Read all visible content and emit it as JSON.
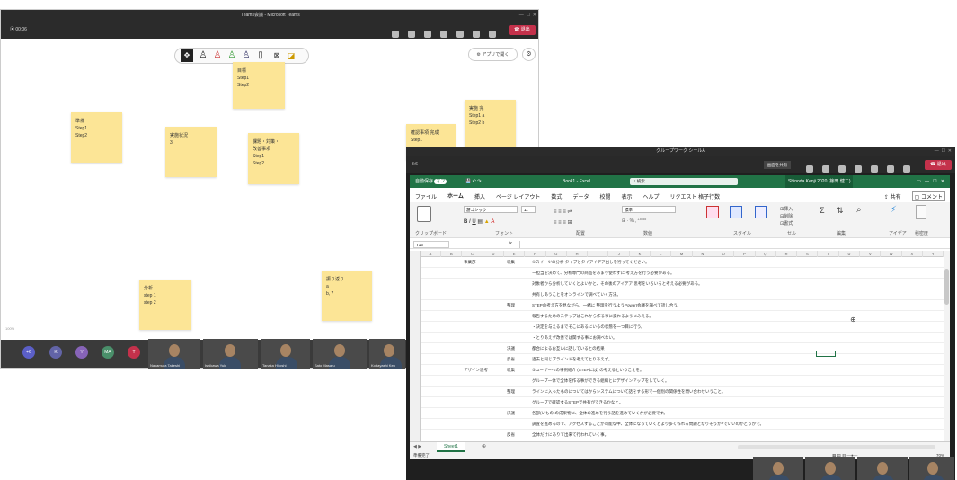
{
  "whiteboard_window": {
    "title": "Teams会議 - Microsoft Teams",
    "timer": "00:06",
    "leave_label": "退出",
    "app_button": "アプリで開く",
    "notes": [
      {
        "id": "top",
        "lines": [
          "目標",
          "Step1",
          "Step2"
        ]
      },
      {
        "id": "left",
        "lines": [
          "準備",
          "Step1",
          "Step2"
        ]
      },
      {
        "id": "mid1",
        "lines": [
          "実施状況",
          "3"
        ]
      },
      {
        "id": "mid2",
        "lines": [
          "課題・対策・",
          "改善事項",
          "Step1",
          "Step2"
        ]
      },
      {
        "id": "right1",
        "lines": [
          "実施 完",
          "Step1 a",
          "Step2 b"
        ]
      },
      {
        "id": "right2",
        "lines": [
          "確認事項 完成",
          "Step1"
        ]
      },
      {
        "id": "bottom1",
        "lines": [
          "分析",
          "step 1",
          "step 2"
        ]
      },
      {
        "id": "bottom2",
        "lines": [
          "振り返り",
          "a",
          "b, 7"
        ]
      }
    ],
    "zoom_label": "100%",
    "avatars": [
      {
        "label": "+6",
        "color": "#5b5fc7"
      },
      {
        "label": "K",
        "color": "#6264a7"
      },
      {
        "label": "Y",
        "color": "#8764b8"
      },
      {
        "label": "MA",
        "color": "#4a8f6a"
      },
      {
        "label": "T",
        "color": "#c4314b"
      }
    ],
    "video_names": [
      "Nakamura Takeshi",
      "Ishikawa Yuki",
      "Tanaka Hiroshi",
      "Sato Masaru",
      "Kobayashi Ken"
    ]
  },
  "excel_window": {
    "title": "グループワーク シールA",
    "left_timer": "3:6",
    "share_button": "画面を共有",
    "leave_label": "退出",
    "autosave": "自動保存",
    "autosave_state": "オフ",
    "file_name": "Book1 - Excel",
    "search_placeholder": "検索",
    "user": "Shinoda Kenji 2020 (篠田 健二)",
    "tabs": [
      "ファイル",
      "ホーム",
      "挿入",
      "ページ レイアウト",
      "数式",
      "データ",
      "校閲",
      "表示",
      "ヘルプ",
      "リクエスト 格子行数"
    ],
    "share_label": "共有",
    "comment_label": "コメント",
    "font_name": "游ゴシック",
    "font_size": "11",
    "number_format": "標準",
    "groups": [
      "クリップボード",
      "フォント",
      "配置",
      "数値",
      "スタイル",
      "セル",
      "編集",
      "アイデア",
      "秘密度"
    ],
    "name_box": "T16",
    "formula_fx": "fx",
    "column_headers": [
      "A",
      "B",
      "C",
      "D",
      "E",
      "F",
      "G",
      "H",
      "I",
      "J",
      "K",
      "L",
      "M",
      "N",
      "O",
      "P",
      "Q",
      "R",
      "S",
      "T",
      "U",
      "V",
      "W",
      "X",
      "Y"
    ],
    "rows": [
      {
        "label": "",
        "b": "事業部",
        "c": "収集",
        "text": "①スイーツの分析 タイプとタイアイデア出しを行ってください。"
      },
      {
        "label": "",
        "b": "",
        "c": "",
        "text": "ー担当を決めて、分析専門の商品をあまり使わずに 考え方を行う必要がある。"
      },
      {
        "label": "",
        "b": "",
        "c": "",
        "text": "対象者から分析していくとよいかと、その後のアイデア 思考をいろいろと考える必要がある。"
      },
      {
        "label": "",
        "b": "",
        "c": "",
        "text": "共有しあうことをオンラインで調べていく方法。"
      },
      {
        "label": "",
        "b": "",
        "c": "整理",
        "text": "STEPの考え方を見ながら、一緒に 整理を行うようPowerI会議を調べて話し合う。"
      },
      {
        "label": "",
        "b": "",
        "c": "",
        "text": "報告するためのステップはこれから作る事に変わるようにみえる。"
      },
      {
        "label": "",
        "b": "",
        "c": "",
        "text": "・決定を与えるまでそこにあるにいるの状態を一つ目に行う。"
      },
      {
        "label": "",
        "b": "",
        "c": "",
        "text": "・とりあえず改善では関する事にお調べない。"
      },
      {
        "label": "",
        "b": "",
        "c": "決議",
        "text": "都合によるお互いに話しているとの結果"
      },
      {
        "label": "",
        "b": "",
        "c": "反省",
        "text": "過去と同じブラインドを考えてとりあえず。"
      },
      {
        "label": "",
        "b": "デザイン思考",
        "c": "収集",
        "text": "②ユーザーへの事例紹介 (STEPには) の考えるということを。"
      },
      {
        "label": "",
        "b": "",
        "c": "",
        "text": "グループ一体で全体を作る事ができる組織とにデザインアップをしていく。"
      },
      {
        "label": "",
        "b": "",
        "c": "整理",
        "text": "ラインに入ったものについてはからシステムについて話をする形で一個別の関係性を問い合わせいうこと。"
      },
      {
        "label": "",
        "b": "",
        "c": "",
        "text": "グループで確認するSTEPで共有ができるかなと。"
      },
      {
        "label": "",
        "b": "",
        "c": "決議",
        "text": "各部(いもの)の成果物に、全体の進めを行う話を進めていくかが必要です。"
      },
      {
        "label": "",
        "b": "",
        "c": "",
        "text": "調査を進めるので、アクセスすることが可能な中、全体になっていくとより多く作れる問題となりそうか?でいいのかどうかで。"
      },
      {
        "label": "",
        "b": "",
        "c": "反省",
        "text": "全体だけにありて出来て行われていく事。"
      }
    ],
    "sheet_tab": "Sheet1",
    "status_left": "準備完了",
    "zoom": "70%"
  },
  "colors": {
    "teams_dark": "#2b2b2b",
    "leave_red": "#c4314b",
    "excel_green": "#217346",
    "note": "#fce596"
  }
}
